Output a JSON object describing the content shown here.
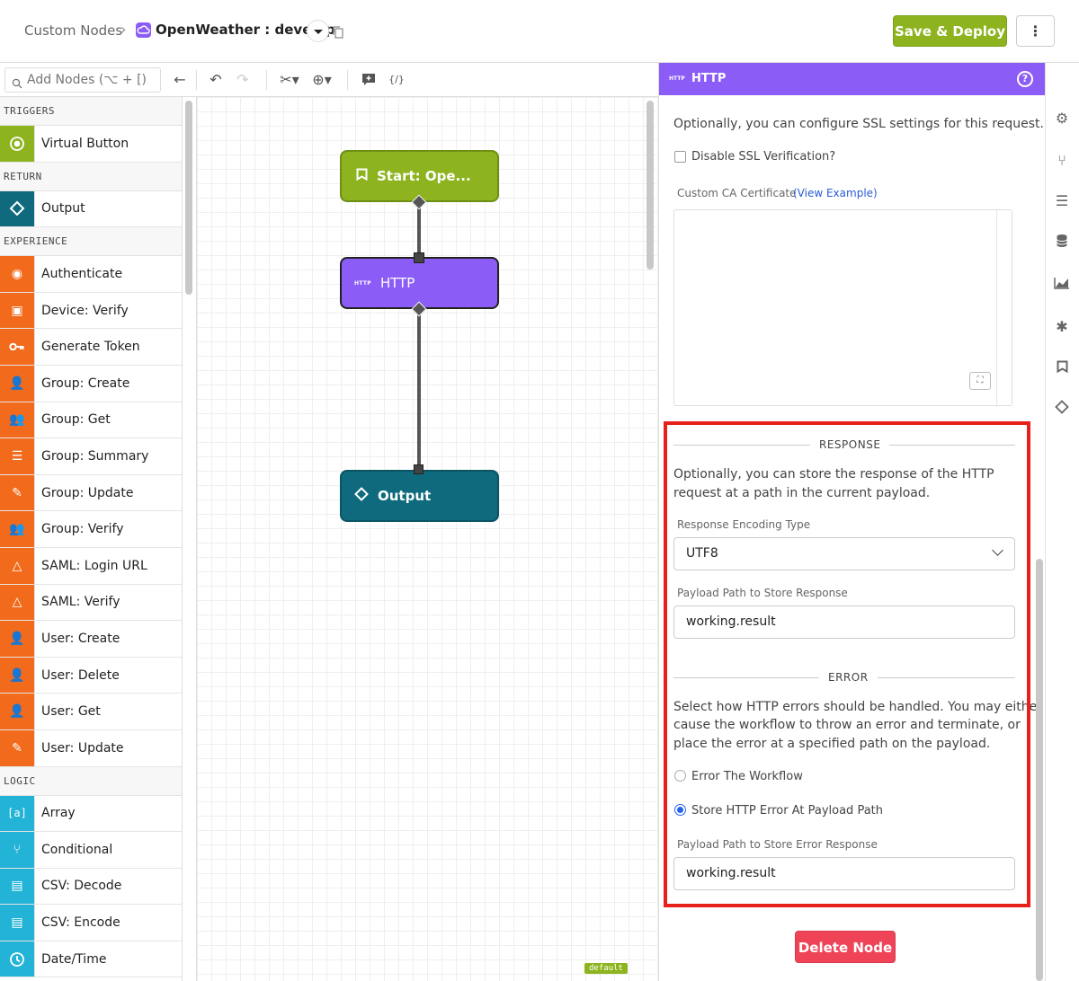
{
  "header": {
    "breadcrumb_root": "Custom Nodes",
    "breadcrumb_sep": "›",
    "app_name": "OpenWeather : develop",
    "save_label": "Save & Deploy",
    "more_label": "⋮"
  },
  "toolbar": {
    "search_placeholder": "Add Nodes (⌥ + [)"
  },
  "sidebar": {
    "sections": {
      "triggers": "TRIGGERS",
      "return": "RETURN",
      "experience": "EXPERIENCE",
      "logic": "LOGIC"
    },
    "triggers": [
      {
        "label": "Virtual Button"
      }
    ],
    "return": [
      {
        "label": "Output"
      }
    ],
    "experience": [
      {
        "label": "Authenticate"
      },
      {
        "label": "Device: Verify"
      },
      {
        "label": "Generate Token"
      },
      {
        "label": "Group: Create"
      },
      {
        "label": "Group: Get"
      },
      {
        "label": "Group: Summary"
      },
      {
        "label": "Group: Update"
      },
      {
        "label": "Group: Verify"
      },
      {
        "label": "SAML: Login URL"
      },
      {
        "label": "SAML: Verify"
      },
      {
        "label": "User: Create"
      },
      {
        "label": "User: Delete"
      },
      {
        "label": "User: Get"
      },
      {
        "label": "User: Update"
      }
    ],
    "logic": [
      {
        "label": "Array"
      },
      {
        "label": "Conditional"
      },
      {
        "label": "CSV: Decode"
      },
      {
        "label": "CSV: Encode"
      },
      {
        "label": "Date/Time"
      }
    ]
  },
  "canvas": {
    "nodes": {
      "start": "Start: Ope...",
      "http": "HTTP",
      "http_tag": "HTTP",
      "output": "Output"
    },
    "default_tag": "default"
  },
  "panel": {
    "tag": "HTTP",
    "title": "HTTP",
    "help": "?",
    "ssl_intro": "Optionally, you can configure SSL settings for this request.",
    "disable_ssl_label": "Disable SSL Verification?",
    "custom_ca_label": "Custom CA Certificate",
    "view_example": "(View Example)",
    "response_heading": "RESPONSE",
    "response_intro_1": "Optionally, you can store the response of the HTTP",
    "response_intro_2": "request at a path in the current payload.",
    "encoding_label": "Response Encoding Type",
    "encoding_value": "UTF8",
    "payload_path_label": "Payload Path to Store Response",
    "payload_path_value": "working.result",
    "error_heading": "ERROR",
    "error_intro_1": "Select how HTTP errors should be handled. You may either",
    "error_intro_2": "cause the workflow to throw an error and terminate, or",
    "error_intro_3": "place the error at a specified path on the payload.",
    "radio_error_workflow": "Error The Workflow",
    "radio_store_error": "Store HTTP Error At Payload Path",
    "error_path_label": "Payload Path to Store Error Response",
    "error_path_value": "working.result",
    "delete_label": "Delete Node",
    "radio_selected": "Store HTTP Error At Payload Path"
  },
  "rail_icons": [
    "gear-icon",
    "branch-icon",
    "list-icon",
    "database-icon",
    "chart-icon",
    "bug-icon",
    "bookmark-icon",
    "diamond-icon"
  ],
  "colors": {
    "accent_green": "#8db31f",
    "http_purple": "#8b5cf6",
    "teal": "#0e6a7c",
    "orange": "#f26a1b",
    "cyan": "#22b3d6",
    "delete_red": "#ef4457",
    "highlight_red": "#e8201a"
  }
}
